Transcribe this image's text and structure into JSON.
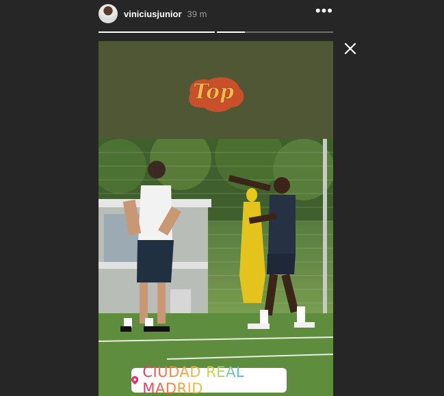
{
  "header": {
    "username": "viniciusjunior",
    "time": "39 m",
    "more_label": "•••"
  },
  "progress": {
    "segments": [
      {
        "progress": 1.0
      },
      {
        "progress": 0.24
      }
    ]
  },
  "story": {
    "sticker_text": "Top",
    "location": "CIUDAD REAL MADRID"
  },
  "colors": {
    "background": "#262626",
    "story_background": "#4f5735",
    "sticker": "#f3a33a"
  },
  "icons": {
    "close": "close-icon",
    "more": "more-options-icon",
    "location": "location-pin-icon"
  }
}
